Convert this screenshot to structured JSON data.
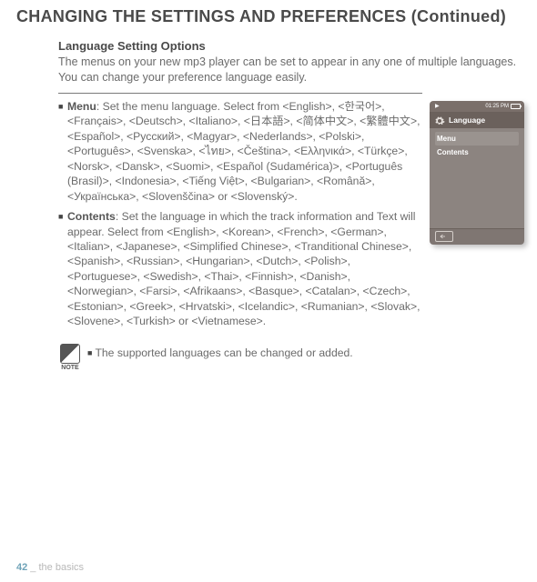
{
  "page_title": "CHANGING THE SETTINGS AND PREFERENCES (Continued)",
  "section_title": "Language Setting Options",
  "intro": "The menus on your new mp3 player can be set to appear in any one of multiple languages. You can change your preference language easily.",
  "items": [
    {
      "title": "Menu",
      "body": ": Set the menu language. Select from <English>, <한국어>, <Français>, <Deutsch>, <Italiano>, <日本語>, <简体中文>, <繁體中文>, <Español>, <Русский>, <Magyar>, <Nederlands>, <Polski>, <Português>, <Svenska>, <ไทย>, <Čeština>, <Ελληνικά>, <Türkçe>, <Norsk>, <Dansk>, <Suomi>, <Español (Sudamérica)>, <Português (Brasil)>, <Indonesia>, <Tiếng Việt>, <Bulgarian>, <Română>, <Українська>, <Slovenščina> or <Slovenský>."
    },
    {
      "title": "Contents",
      "body": ": Set the language in which the track information and Text will appear. Select from <English>, <Korean>, <French>, <German>, <Italian>, <Japanese>, <Simplified Chinese>, <Tranditional Chinese>, <Spanish>, <Russian>, <Hungarian>, <Dutch>, <Polish>, <Portuguese>, <Swedish>, <Thai>, <Finnish>, <Danish>, <Norwegian>, <Farsi>, <Afrikaans>, <Basque>, <Catalan>, <Czech>, <Estonian>, <Greek>, <Hrvatski>, <Icelandic>, <Rumanian>, <Slovak>, <Slovene>, <Turkish> or <Vietnamese>."
    }
  ],
  "note": {
    "label": "NOTE",
    "text": "The supported languages can be changed or added."
  },
  "device": {
    "status_time": "01:25 PM",
    "header_title": "Language",
    "menu": [
      "Menu",
      "Contents"
    ]
  },
  "footer": {
    "page": "42",
    "sep": " _ ",
    "section": "the basics"
  }
}
